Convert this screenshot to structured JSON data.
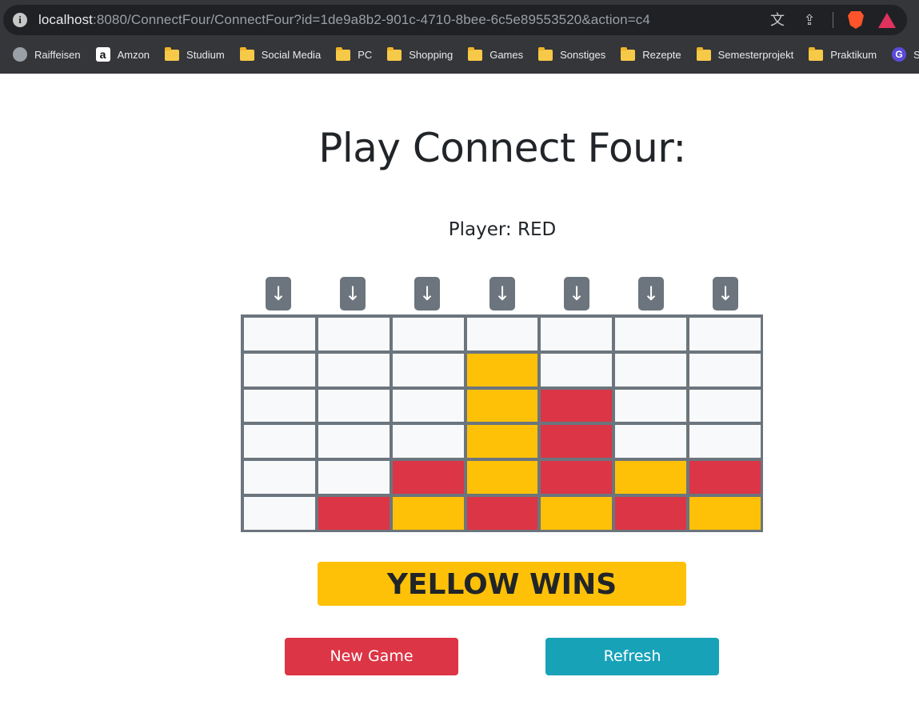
{
  "browser": {
    "url_prefix": "",
    "url_host": "localhost",
    "url_rest": ":8080/ConnectFour/ConnectFour?id=1de9a8b2-901c-4710-8bee-6c5e89553520&action=c4",
    "icons": [
      "info-icon",
      "translate-icon",
      "share-icon",
      "brave-shields-icon",
      "brave-rewards-icon"
    ],
    "bookmarks": [
      {
        "label": "Raiffeisen",
        "icon": "globe-icon"
      },
      {
        "label": "Amzon",
        "icon": "amazon-icon"
      },
      {
        "label": "Studium",
        "icon": "folder-icon"
      },
      {
        "label": "Social Media",
        "icon": "folder-icon"
      },
      {
        "label": "PC",
        "icon": "folder-icon"
      },
      {
        "label": "Shopping",
        "icon": "folder-icon"
      },
      {
        "label": "Games",
        "icon": "folder-icon"
      },
      {
        "label": "Sonstiges",
        "icon": "folder-icon"
      },
      {
        "label": "Rezepte",
        "icon": "folder-icon"
      },
      {
        "label": "Semesterprojekt",
        "icon": "folder-icon"
      },
      {
        "label": "Praktikum",
        "icon": "folder-icon"
      },
      {
        "label": "SUPR",
        "icon": "g-icon"
      }
    ]
  },
  "page": {
    "title": "Play Connect Four:",
    "player_label": "Player: RED",
    "drop_glyph": "↓",
    "result_text": "YELLOW WINS",
    "new_game_label": "New Game",
    "refresh_label": "Refresh"
  },
  "board": [
    [
      "",
      "",
      "",
      "",
      "",
      "",
      ""
    ],
    [
      "",
      "",
      "",
      "Y",
      "",
      "",
      ""
    ],
    [
      "",
      "",
      "",
      "Y",
      "R",
      "",
      ""
    ],
    [
      "",
      "",
      "",
      "Y",
      "R",
      "",
      ""
    ],
    [
      "",
      "",
      "R",
      "Y",
      "R",
      "Y",
      "R"
    ],
    [
      "",
      "R",
      "Y",
      "R",
      "Y",
      "R",
      "Y"
    ]
  ],
  "colors": {
    "red": "#dc3545",
    "yellow": "#ffc107",
    "empty": "#f8f9fa",
    "board_frame": "#6c757d",
    "refresh": "#17a2b8"
  }
}
